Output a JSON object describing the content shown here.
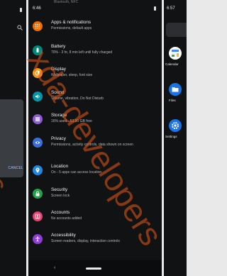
{
  "left_panel": {
    "dialog_action": "CANCEL"
  },
  "settings": {
    "time": "6:46",
    "cut_text": "Bluetooth, NFC",
    "items": [
      {
        "title": "Apps & notifications",
        "subtitle": "Permissions, default apps",
        "icon": "apps-icon",
        "color": "#ef6c00"
      },
      {
        "title": "Battery",
        "subtitle": "70% - 3 hr, 8 min left until fully charged",
        "icon": "battery-icon",
        "color": "#00897b"
      },
      {
        "title": "Display",
        "subtitle": "Wallpaper, sleep, font size",
        "icon": "display-icon",
        "color": "#f59b15"
      },
      {
        "title": "Sound",
        "subtitle": "Volume, vibration, Do Not Disturb",
        "icon": "sound-icon",
        "color": "#0097a7"
      },
      {
        "title": "Storage",
        "subtitle": "16% used - 53.90 GB free",
        "icon": "storage-icon",
        "color": "#8e5ad8"
      },
      {
        "title": "Privacy",
        "subtitle": "Permissions, activity controls, data shown on screen",
        "icon": "privacy-icon",
        "color": "#3a6fd8"
      },
      {
        "title": "Location",
        "subtitle": "On - 5 apps can access location",
        "icon": "location-icon",
        "color": "#1e88e5"
      },
      {
        "title": "Security",
        "subtitle": "Screen lock",
        "icon": "security-icon",
        "color": "#24a148"
      },
      {
        "title": "Accounts",
        "subtitle": "No accounts added",
        "icon": "accounts-icon",
        "color": "#e53f6f"
      },
      {
        "title": "Accessibility",
        "subtitle": "Screen readers, display, interaction controls",
        "icon": "accessibility-icon",
        "color": "#8e3bd8"
      }
    ],
    "nav_back": "‹"
  },
  "launcher": {
    "time": "6:57",
    "apps": [
      {
        "label": "Calendar",
        "icon": "calendar-icon",
        "color": "#ffffff"
      },
      {
        "label": "Files",
        "icon": "files-icon",
        "color": "#1a73e8"
      },
      {
        "label": "Settings",
        "icon": "settings-icon",
        "color": "#1a73e8"
      }
    ]
  },
  "watermark": "xda-developers"
}
